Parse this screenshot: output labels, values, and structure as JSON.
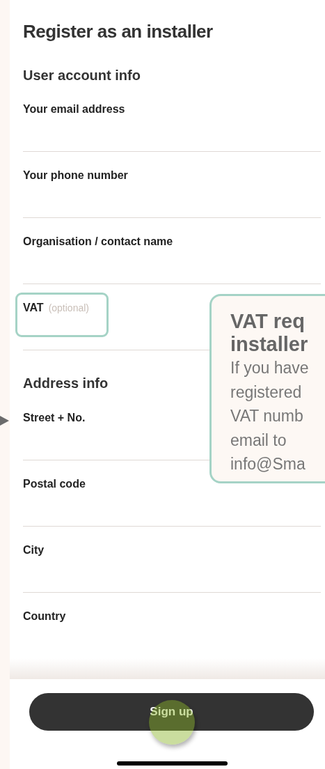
{
  "title": "Register as an installer",
  "sections": [
    {
      "heading": "User account info",
      "fields": [
        {
          "label": "Your email address",
          "highlighted": false
        },
        {
          "label": "Your phone number",
          "highlighted": false
        },
        {
          "label": "Organisation / contact name",
          "highlighted": false
        },
        {
          "label": "VAT",
          "hint": "(optional)",
          "highlighted": true
        }
      ]
    },
    {
      "heading": "Address info",
      "fields": [
        {
          "label": "Street + No.",
          "highlighted": false
        },
        {
          "label": "Postal code",
          "highlighted": false
        },
        {
          "label": "City",
          "highlighted": false
        },
        {
          "label": "Country",
          "highlighted": false
        }
      ]
    }
  ],
  "tooltip": {
    "title_lines": [
      "VAT req",
      "installer"
    ],
    "body_lines": [
      "If you have",
      "registered",
      "VAT numb",
      "email to",
      "info@Sma"
    ]
  },
  "sign_up_button": "Sign up"
}
